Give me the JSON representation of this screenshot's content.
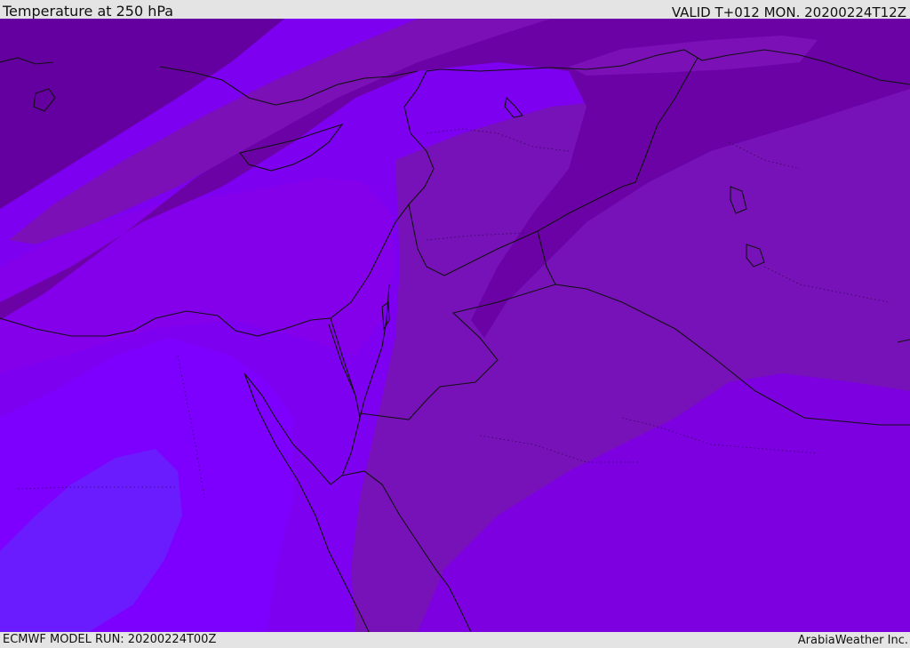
{
  "header": {
    "title": "Temperature at 250 hPa",
    "valid": "VALID T+012 MON. 20200224T12Z"
  },
  "footer": {
    "model_run": "ECMWF MODEL RUN: 20200224T00Z",
    "credit": "ArabiaWeather Inc."
  },
  "map": {
    "field": "Temperature at 250 hPa",
    "palette": {
      "coldest": "#6a00a3",
      "cold": "#7a14b8",
      "mid": "#8400e6",
      "warm": "#7c00ff",
      "warmest": "#6a1aff",
      "coast": "#111111"
    }
  }
}
